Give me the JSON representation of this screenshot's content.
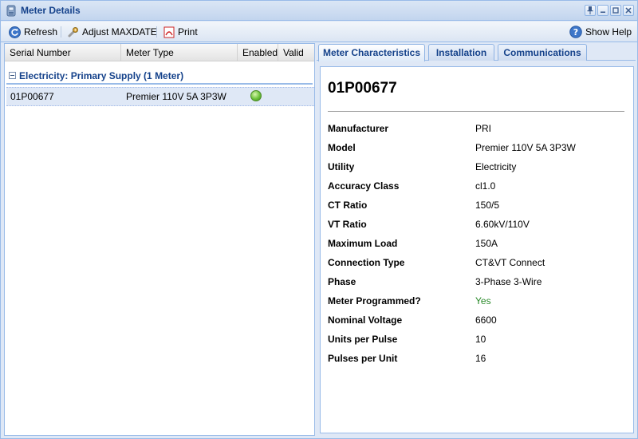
{
  "window": {
    "title": "Meter Details"
  },
  "toolbar": {
    "refresh_label": "Refresh",
    "adjust_label": "Adjust MAXDATE",
    "print_label": "Print",
    "help_label": "Show Help"
  },
  "grid": {
    "columns": [
      "Serial Number",
      "Meter Type",
      "Enabled",
      "Valid"
    ],
    "group_label": "Electricity: Primary Supply (1 Meter)",
    "rows": [
      {
        "serial": "01P00677",
        "type": "Premier 110V 5A 3P3W",
        "enabled": true
      }
    ]
  },
  "tabs": [
    "Meter Characteristics",
    "Installation",
    "Communications"
  ],
  "details": {
    "title": "01P00677",
    "props": [
      {
        "label": "Manufacturer",
        "value": "PRI"
      },
      {
        "label": "Model",
        "value": "Premier 110V 5A 3P3W"
      },
      {
        "label": "Utility",
        "value": "Electricity"
      },
      {
        "label": "Accuracy Class",
        "value": "cl1.0"
      },
      {
        "label": "CT Ratio",
        "value": "150/5"
      },
      {
        "label": "VT Ratio",
        "value": "6.60kV/110V"
      },
      {
        "label": "Maximum Load",
        "value": "150A"
      },
      {
        "label": "Connection Type",
        "value": "CT&VT Connect"
      },
      {
        "label": "Phase",
        "value": "3-Phase 3-Wire"
      },
      {
        "label": "Meter Programmed?",
        "value": "Yes"
      },
      {
        "label": "Nominal Voltage",
        "value": "6600"
      },
      {
        "label": "Units per Pulse",
        "value": "10"
      },
      {
        "label": "Pulses per Unit",
        "value": "16"
      }
    ]
  },
  "colors": {
    "header_text": "#15428b",
    "programmed_yes": "#2a8a2a",
    "border": "#99bbe8"
  }
}
